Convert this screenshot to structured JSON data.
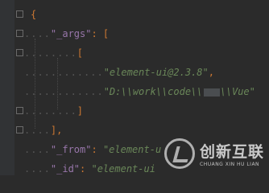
{
  "editor": {
    "lines": [
      {
        "indent": "",
        "tokens": [
          {
            "t": "{",
            "c": "punc"
          }
        ]
      },
      {
        "indent": "....",
        "tokens": [
          {
            "t": "\"_args\"",
            "c": "key"
          },
          {
            "t": ": [",
            "c": "punc"
          }
        ]
      },
      {
        "indent": "........",
        "tokens": [
          {
            "t": "[",
            "c": "punc"
          }
        ]
      },
      {
        "indent": "............",
        "tokens": [
          {
            "t": "\"element-ui@2.3.8\"",
            "c": "str"
          },
          {
            "t": ",",
            "c": "punc"
          }
        ]
      },
      {
        "indent": "............",
        "tokens": [
          {
            "t": "\"D:\\\\work\\\\code\\\\",
            "c": "str"
          },
          {
            "t": "",
            "c": "mask"
          },
          {
            "t": "\\\\Vue\"",
            "c": "str"
          }
        ]
      },
      {
        "indent": "........",
        "tokens": [
          {
            "t": "]",
            "c": "punc"
          }
        ]
      },
      {
        "indent": "....",
        "tokens": [
          {
            "t": "],",
            "c": "punc"
          }
        ]
      },
      {
        "indent": "....",
        "tokens": [
          {
            "t": "\"_from\"",
            "c": "key"
          },
          {
            "t": ": ",
            "c": "punc"
          },
          {
            "t": "\"element-u",
            "c": "str"
          }
        ]
      },
      {
        "indent": "....",
        "tokens": [
          {
            "t": "\"_id\"",
            "c": "key"
          },
          {
            "t": ": ",
            "c": "punc"
          },
          {
            "t": "\"element-ui",
            "c": "str"
          }
        ]
      }
    ]
  },
  "watermark": {
    "name_cn": "创新互联",
    "name_en": "CHUANG XIN HU LIAN"
  }
}
